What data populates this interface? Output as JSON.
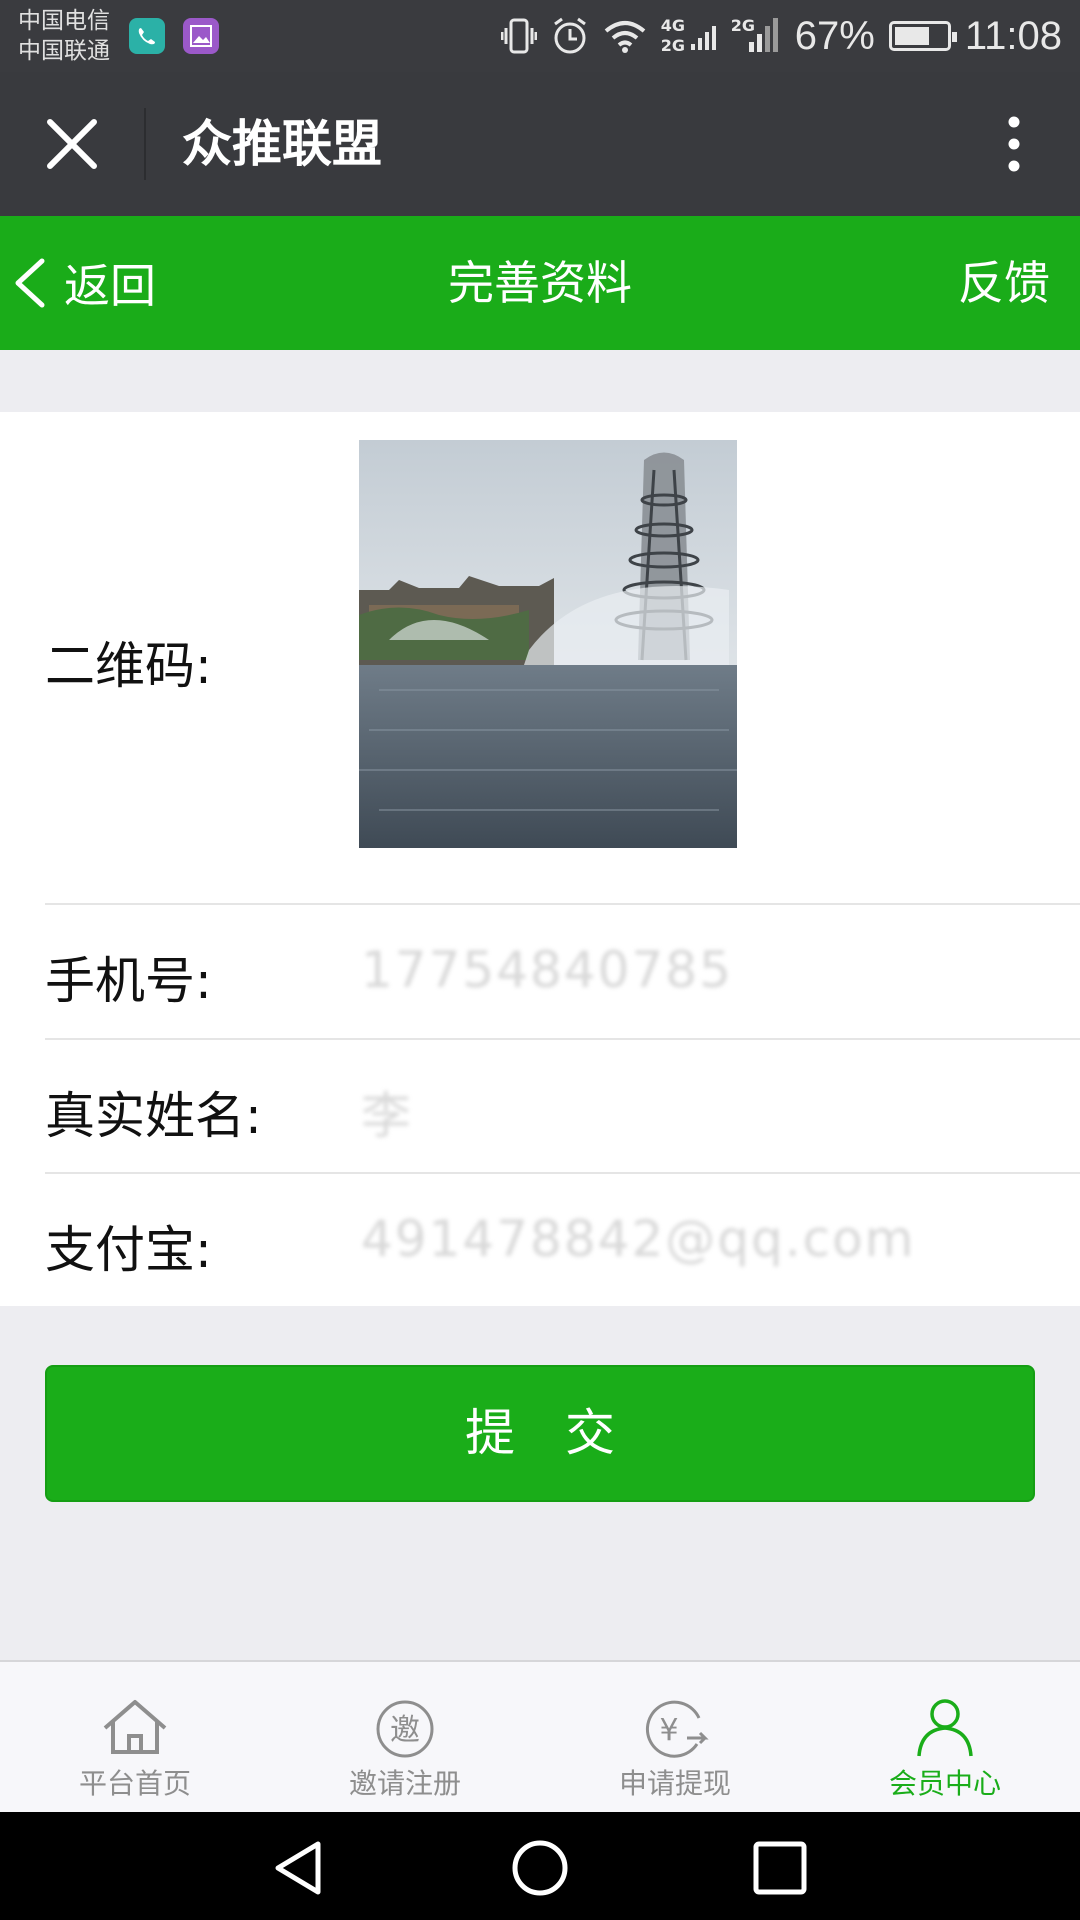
{
  "status_bar": {
    "carriers": [
      "中国电信",
      "中国联通"
    ],
    "network_labels": [
      "4G",
      "2G",
      "2G"
    ],
    "battery_percent": "67%",
    "battery_level": 0.67,
    "time": "11:08"
  },
  "wechat_bar": {
    "title": "众推联盟",
    "close_icon": "close-icon",
    "more_icon": "more-vertical-icon"
  },
  "nav": {
    "back_label": "返回",
    "title": "完善资料",
    "feedback_label": "反馈"
  },
  "form": {
    "qr_label": "二维码:",
    "phone_label": "手机号:",
    "phone_value": "17754840785",
    "name_label": "真实姓名:",
    "name_value": "李",
    "alipay_label": "支付宝:",
    "alipay_value": "491478842@qq.com"
  },
  "submit_label": "提交",
  "tabs": [
    {
      "label": "平台首页",
      "icon": "home-icon",
      "active": false
    },
    {
      "label": "邀请注册",
      "icon": "invite-icon",
      "active": false
    },
    {
      "label": "申请提现",
      "icon": "withdraw-icon",
      "active": false
    },
    {
      "label": "会员中心",
      "icon": "member-icon",
      "active": true
    }
  ],
  "colors": {
    "primary_green": "#1aac19",
    "wechat_bar": "#393a3e",
    "tab_inactive": "#8e8e8e"
  }
}
